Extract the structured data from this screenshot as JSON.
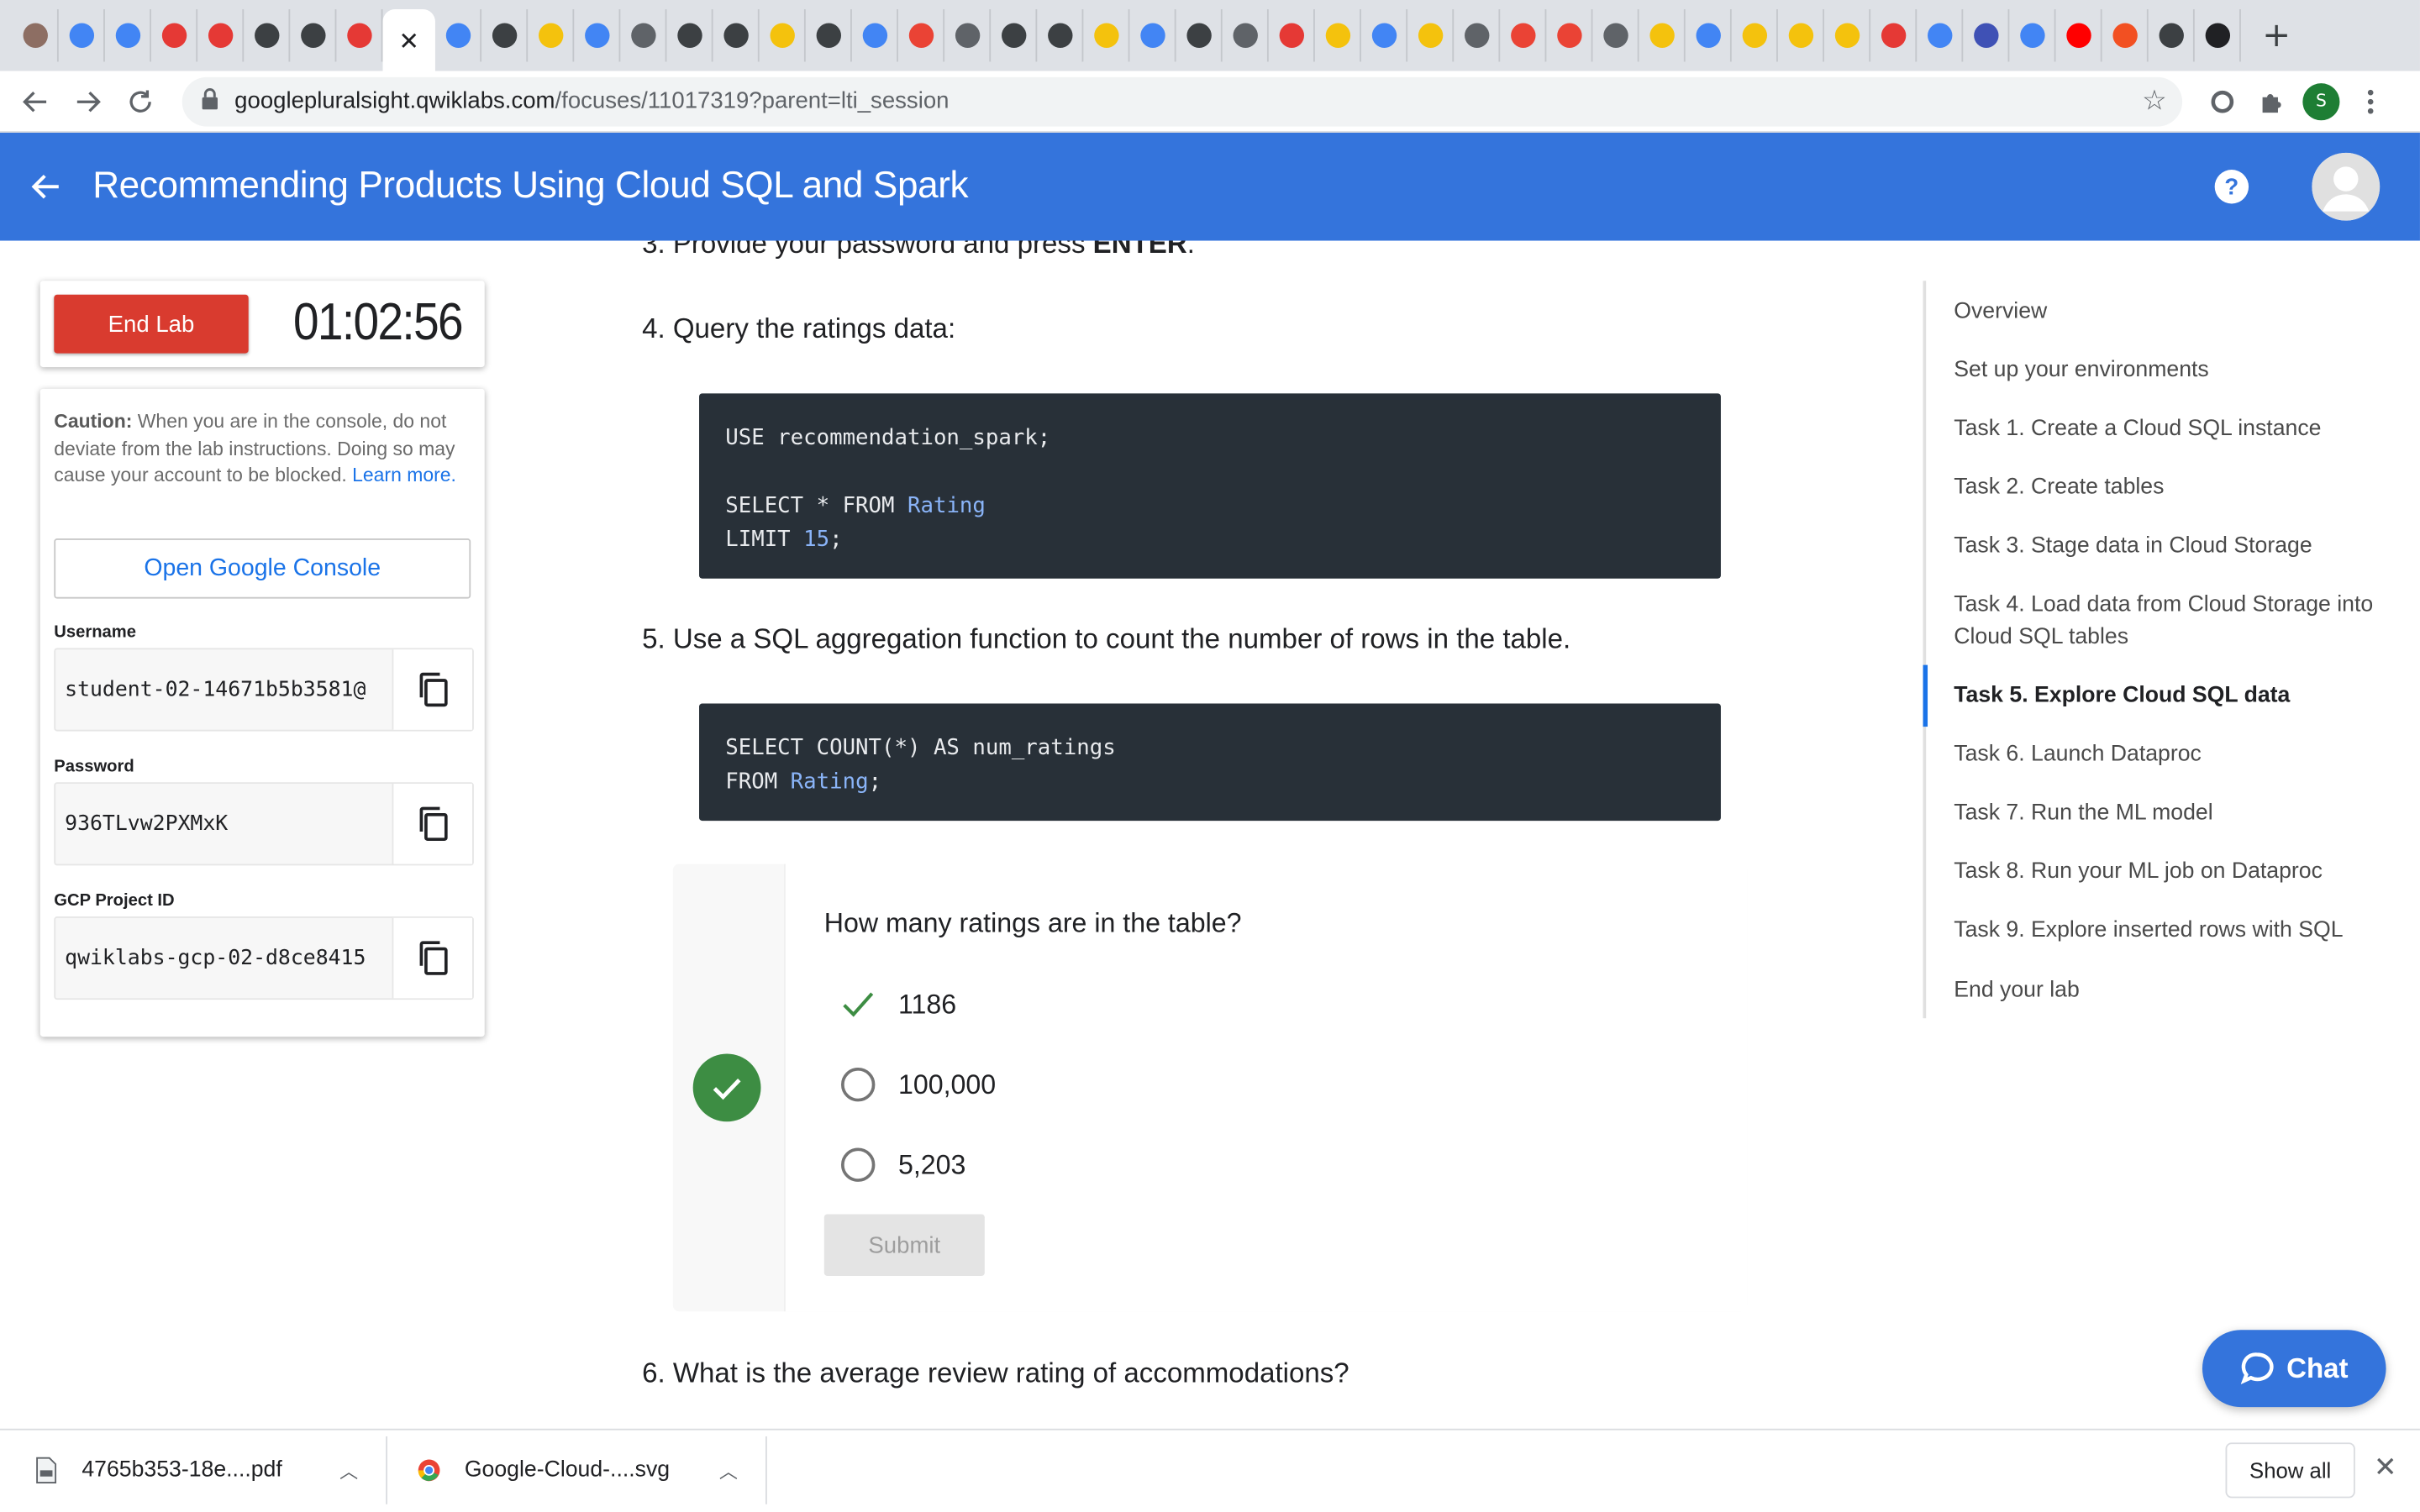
{
  "browser": {
    "tab_favicons": [
      {
        "icon": "book-icon",
        "color": "#8d6e63"
      },
      {
        "icon": "video-icon",
        "color": "#4285f4"
      },
      {
        "icon": "video-icon",
        "color": "#4285f4"
      },
      {
        "icon": "play-icon",
        "color": "#e53935"
      },
      {
        "icon": "play-icon",
        "color": "#e53935"
      },
      {
        "icon": "globe-icon",
        "color": "#3c4043"
      },
      {
        "icon": "globe-icon",
        "color": "#3c4043"
      },
      {
        "icon": "play-icon",
        "color": "#e53935"
      },
      {
        "icon": "close-icon",
        "color": "#202124",
        "active": true
      },
      {
        "icon": "layers-icon",
        "color": "#4285f4"
      },
      {
        "icon": "globe-icon",
        "color": "#3c4043"
      },
      {
        "icon": "qwiklabs-icon",
        "color": "#f4c20d"
      },
      {
        "icon": "hexagon-icon",
        "color": "#4285f4"
      },
      {
        "icon": "grid-icon",
        "color": "#5f6368"
      },
      {
        "icon": "globe-icon",
        "color": "#3c4043"
      },
      {
        "icon": "globe-icon",
        "color": "#3c4043"
      },
      {
        "icon": "qwiklabs-icon",
        "color": "#f4c20d"
      },
      {
        "icon": "globe-icon",
        "color": "#3c4043"
      },
      {
        "icon": "shield-icon",
        "color": "#4285f4"
      },
      {
        "icon": "cloud-icon",
        "color": "#ea4335"
      },
      {
        "icon": "monitor-icon",
        "color": "#5f6368"
      },
      {
        "icon": "globe-icon",
        "color": "#3c4043"
      },
      {
        "icon": "globe-icon",
        "color": "#3c4043"
      },
      {
        "icon": "qwiklabs-icon",
        "color": "#f4c20d"
      },
      {
        "icon": "chip-icon",
        "color": "#4285f4"
      },
      {
        "icon": "globe-icon",
        "color": "#3c4043"
      },
      {
        "icon": "chip-icon",
        "color": "#5f6368"
      },
      {
        "icon": "play-icon",
        "color": "#e53935"
      },
      {
        "icon": "qwiklabs-icon",
        "color": "#f4c20d"
      },
      {
        "icon": "search-icon",
        "color": "#4285f4"
      },
      {
        "icon": "qwiklabs-icon",
        "color": "#f4c20d"
      },
      {
        "icon": "hexagon-icon",
        "color": "#5f6368"
      },
      {
        "icon": "cloud-icon",
        "color": "#ea4335"
      },
      {
        "icon": "cloud-icon",
        "color": "#ea4335"
      },
      {
        "icon": "chip-icon",
        "color": "#5f6368"
      },
      {
        "icon": "qwiklabs-icon",
        "color": "#f4c20d"
      },
      {
        "icon": "chip-icon",
        "color": "#4285f4"
      },
      {
        "icon": "qwiklabs-icon",
        "color": "#f4c20d"
      },
      {
        "icon": "qwiklabs-icon",
        "color": "#f4c20d"
      },
      {
        "icon": "qwiklabs-icon",
        "color": "#f4c20d"
      },
      {
        "icon": "play-icon",
        "color": "#e53935"
      },
      {
        "icon": "doc-icon",
        "color": "#4285f4"
      },
      {
        "icon": "list-icon",
        "color": "#3f51b5"
      },
      {
        "icon": "gear-icon",
        "color": "#4285f4"
      },
      {
        "icon": "youtube-icon",
        "color": "#ff0000"
      },
      {
        "icon": "windows-icon",
        "color": "#f25022"
      },
      {
        "icon": "globe-icon",
        "color": "#3c4043"
      },
      {
        "icon": "github-icon",
        "color": "#202124"
      }
    ],
    "new_tab_label": "+",
    "url_host": "googlepluralsight.qwiklabs.com",
    "url_path": "/focuses/11017319?parent=lti_session",
    "profile_initial": "S"
  },
  "header": {
    "title": "Recommending Products Using Cloud SQL and Spark",
    "help_label": "?"
  },
  "lab": {
    "end_lab_label": "End Lab",
    "timer": "01:02:56",
    "caution_bold": "Caution:",
    "caution_text": " When you are in the console, do not deviate from the lab instructions. Doing so may cause your account to be blocked. ",
    "learn_more": "Learn more.",
    "open_console_label": "Open Google Console",
    "username_label": "Username",
    "username_value": "student-02-14671b5b3581@",
    "password_label": "Password",
    "password_value": "936TLvw2PXMxK",
    "project_label": "GCP Project ID",
    "project_value": "qwiklabs-gcp-02-d8ce8415"
  },
  "content": {
    "step3_prefix": "3. Provide your password and press ",
    "step3_bold": "ENTER",
    "step3_suffix": ".",
    "step4": "4. Query the ratings data:",
    "code1": {
      "line1": "USE recommendation_spark;",
      "line3_kw": "SELECT * FROM ",
      "line3_id": "Rating",
      "line4_kw": "LIMIT ",
      "line4_num": "15",
      "line4_end": ";"
    },
    "step5": "5. Use a SQL aggregation function to count the number of rows in the table.",
    "code2": {
      "line1": "SELECT COUNT(*) AS num_ratings",
      "line2_kw": "FROM ",
      "line2_id": "Rating",
      "line2_end": ";"
    },
    "quiz": {
      "question": "How many ratings are in the table?",
      "options": [
        {
          "label": "1186",
          "selected": true
        },
        {
          "label": "100,000",
          "selected": false
        },
        {
          "label": "5,203",
          "selected": false
        }
      ],
      "submit_label": "Submit",
      "status": "correct"
    },
    "step6": "6. What is the average review rating of accommodations?"
  },
  "toc": {
    "items": [
      {
        "label": "Overview"
      },
      {
        "label": "Set up your environments"
      },
      {
        "label": "Task 1. Create a Cloud SQL instance"
      },
      {
        "label": "Task 2. Create tables"
      },
      {
        "label": "Task 3. Stage data in Cloud Storage"
      },
      {
        "label": "Task 4. Load data from Cloud Storage into Cloud SQL tables"
      },
      {
        "label": "Task 5. Explore Cloud SQL data",
        "active": true
      },
      {
        "label": "Task 6. Launch Dataproc"
      },
      {
        "label": "Task 7. Run the ML model"
      },
      {
        "label": "Task 8. Run your ML job on Dataproc"
      },
      {
        "label": "Task 9. Explore inserted rows with SQL"
      },
      {
        "label": "End your lab"
      }
    ]
  },
  "chat_label": "Chat",
  "downloads": {
    "items": [
      {
        "name": "4765b353-18e....pdf",
        "icon": "pdf-file-icon"
      },
      {
        "name": "Google-Cloud-....svg",
        "icon": "chrome-file-icon"
      }
    ],
    "show_all_label": "Show all"
  },
  "colors": {
    "accent": "#3474dc",
    "end_lab": "#d93b2f",
    "success": "#3d8d43",
    "code_bg": "#283038",
    "link": "#1a73e8"
  }
}
